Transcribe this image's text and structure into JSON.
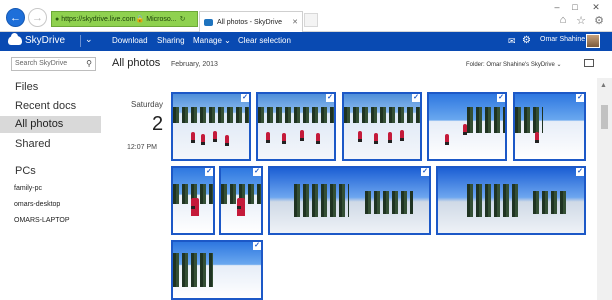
{
  "browser": {
    "url": "https://skydrive.live.com",
    "site_label": "Microso...",
    "tab_title": "All photos - SkyDrive"
  },
  "appbar": {
    "brand": "SkyDrive",
    "commands": [
      "Download",
      "Sharing",
      "Manage",
      "Clear selection"
    ],
    "user_name": "Omar Shahine"
  },
  "sidebar": {
    "search_placeholder": "Search SkyDrive",
    "items": [
      "Files",
      "Recent docs",
      "All photos",
      "Shared"
    ],
    "pcs_heading": "PCs",
    "pcs": [
      "family-pc",
      "omars-desktop",
      "OMARS-LAPTOP"
    ]
  },
  "header": {
    "title": "All photos",
    "date": "February, 2013",
    "folder_label": "Folder: Omar Shahine's SkyDrive"
  },
  "day": {
    "weekday": "Saturday",
    "day": "2",
    "time": "12:07 PM"
  },
  "colors": {
    "brand": "#094ab2",
    "selection": "#1c58c7",
    "address_bar": "#8fd14f"
  },
  "photos_selected": 10
}
